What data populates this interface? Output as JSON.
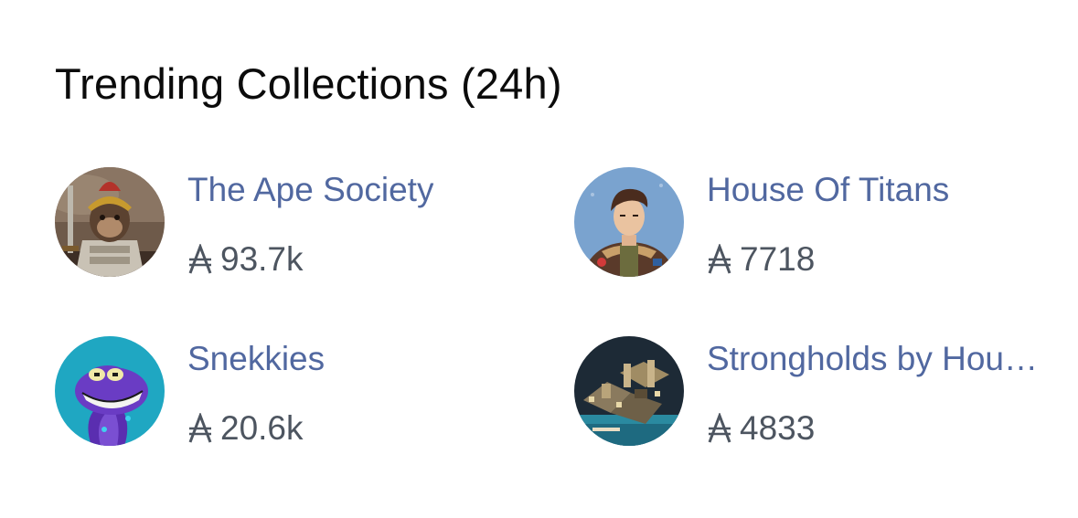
{
  "section": {
    "title": "Trending Collections (24h)"
  },
  "currency": {
    "icon": "ada-currency-icon"
  },
  "collections": [
    {
      "name": "The Ape Society",
      "volume": "93.7k",
      "avatar_icon": "ape-warrior-avatar"
    },
    {
      "name": "House Of Titans",
      "volume": "7718",
      "avatar_icon": "titan-pilot-avatar"
    },
    {
      "name": "Snekkies",
      "volume": "20.6k",
      "avatar_icon": "purple-snake-avatar"
    },
    {
      "name": "Strongholds by Hou…",
      "volume": "4833",
      "avatar_icon": "pixel-castle-avatar"
    }
  ],
  "colors": {
    "name_link": "#5168a0",
    "volume_text": "#4d5560",
    "title_text": "#0b0b0b"
  }
}
